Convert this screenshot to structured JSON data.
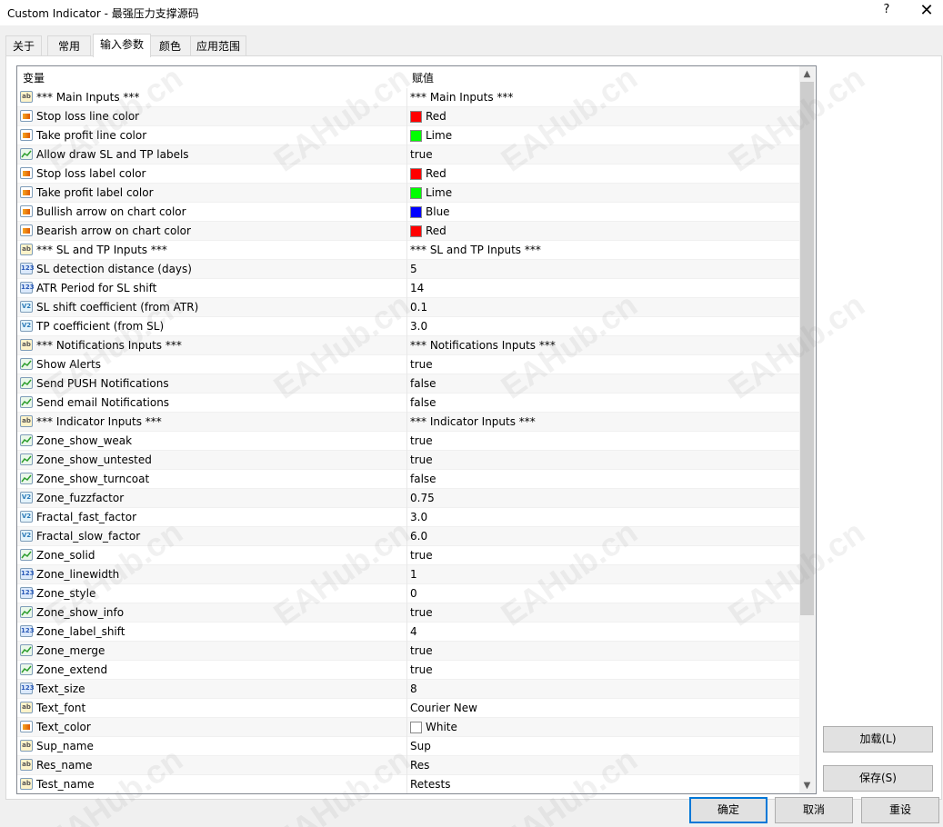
{
  "window": {
    "title": "Custom Indicator - 最强压力支撑源码",
    "help_label": "?",
    "close_label": "✕"
  },
  "tabs": [
    {
      "label": "关于",
      "active": false
    },
    {
      "label": "常用",
      "active": false
    },
    {
      "label": "输入参数",
      "active": true
    },
    {
      "label": "颜色",
      "active": false
    },
    {
      "label": "应用范围",
      "active": false
    }
  ],
  "grid": {
    "col_variable": "变量",
    "col_value": "赋值",
    "rows": [
      {
        "type": "ab",
        "name": "*** Main Inputs ***",
        "value": "*** Main Inputs ***"
      },
      {
        "type": "color",
        "name": "Stop loss line color",
        "value": "Red",
        "swatch": "#ff0000"
      },
      {
        "type": "color",
        "name": "Take profit line color",
        "value": "Lime",
        "swatch": "#00ff00"
      },
      {
        "type": "bool",
        "name": "Allow draw SL and TP labels",
        "value": "true"
      },
      {
        "type": "color",
        "name": "Stop loss label color",
        "value": "Red",
        "swatch": "#ff0000"
      },
      {
        "type": "color",
        "name": "Take profit label color",
        "value": "Lime",
        "swatch": "#00ff00"
      },
      {
        "type": "color",
        "name": "Bullish arrow on chart color",
        "value": "Blue",
        "swatch": "#0000ff"
      },
      {
        "type": "color",
        "name": "Bearish arrow on chart color",
        "value": "Red",
        "swatch": "#ff0000"
      },
      {
        "type": "ab",
        "name": "*** SL and TP Inputs ***",
        "value": "*** SL and TP Inputs ***"
      },
      {
        "type": "int",
        "name": "SL detection distance (days)",
        "value": "5"
      },
      {
        "type": "int",
        "name": "ATR Period for SL shift",
        "value": "14"
      },
      {
        "type": "dbl",
        "name": "SL shift coefficient (from ATR)",
        "value": "0.1"
      },
      {
        "type": "dbl",
        "name": "TP coefficient (from SL)",
        "value": "3.0"
      },
      {
        "type": "ab",
        "name": "*** Notifications Inputs ***",
        "value": "*** Notifications Inputs ***"
      },
      {
        "type": "bool",
        "name": "Show Alerts",
        "value": "true"
      },
      {
        "type": "bool",
        "name": "Send PUSH Notifications",
        "value": "false"
      },
      {
        "type": "bool",
        "name": "Send email Notifications",
        "value": "false"
      },
      {
        "type": "ab",
        "name": "*** Indicator Inputs ***",
        "value": "*** Indicator Inputs ***"
      },
      {
        "type": "bool",
        "name": "Zone_show_weak",
        "value": "true"
      },
      {
        "type": "bool",
        "name": "Zone_show_untested",
        "value": "true"
      },
      {
        "type": "bool",
        "name": "Zone_show_turncoat",
        "value": "false"
      },
      {
        "type": "dbl",
        "name": "Zone_fuzzfactor",
        "value": "0.75"
      },
      {
        "type": "dbl",
        "name": "Fractal_fast_factor",
        "value": "3.0"
      },
      {
        "type": "dbl",
        "name": "Fractal_slow_factor",
        "value": "6.0"
      },
      {
        "type": "bool",
        "name": "Zone_solid",
        "value": "true"
      },
      {
        "type": "int",
        "name": "Zone_linewidth",
        "value": "1"
      },
      {
        "type": "int",
        "name": "Zone_style",
        "value": "0"
      },
      {
        "type": "bool",
        "name": "Zone_show_info",
        "value": "true"
      },
      {
        "type": "int",
        "name": "Zone_label_shift",
        "value": "4"
      },
      {
        "type": "bool",
        "name": "Zone_merge",
        "value": "true"
      },
      {
        "type": "bool",
        "name": "Zone_extend",
        "value": "true"
      },
      {
        "type": "int",
        "name": "Text_size",
        "value": "8"
      },
      {
        "type": "ab",
        "name": "Text_font",
        "value": "Courier New"
      },
      {
        "type": "color",
        "name": "Text_color",
        "value": "White",
        "swatch": "#ffffff"
      },
      {
        "type": "ab",
        "name": "Sup_name",
        "value": "Sup"
      },
      {
        "type": "ab",
        "name": "Res_name",
        "value": "Res"
      },
      {
        "type": "ab",
        "name": "Test_name",
        "value": "Retests"
      }
    ]
  },
  "side_buttons": {
    "load": "加载(L)",
    "save": "保存(S)"
  },
  "bottom_buttons": {
    "ok": "确定",
    "cancel": "取消",
    "reset": "重设"
  },
  "watermark": "EAHub.cn",
  "icon_text": {
    "ab": "ab",
    "int": "123",
    "dbl": "V2"
  }
}
